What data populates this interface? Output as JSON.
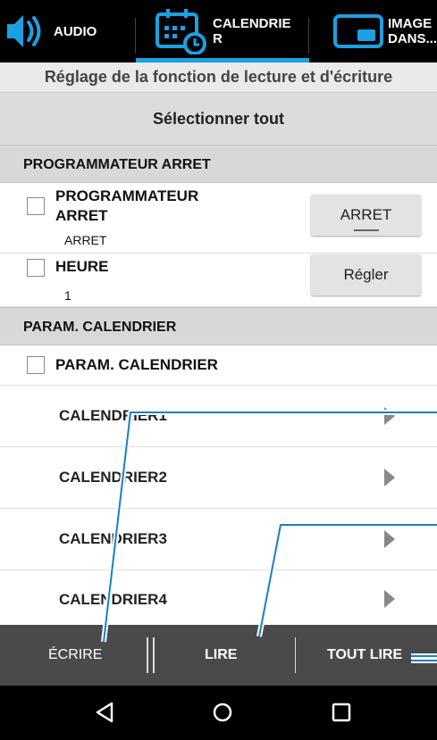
{
  "tabs": [
    {
      "label": "AUDIO",
      "icon": "speaker-icon"
    },
    {
      "label_line1": "CALENDRIE",
      "label_line2": "R",
      "icon": "calendar-clock-icon",
      "active": true
    },
    {
      "label_line1": "IMAGE",
      "label_line2": "DANS...",
      "icon": "picture-in-picture-icon"
    }
  ],
  "subtitle": "Réglage de la fonction de lecture et d'écriture",
  "select_all": "Sélectionner tout",
  "sections": {
    "timer": "PROGRAMMATEUR ARRET",
    "calendar": "PARAM. CALENDRIER"
  },
  "rows": {
    "timer_title_line1": "PROGRAMMATEUR",
    "timer_title_line2": "ARRET",
    "timer_value": "ARRET",
    "timer_button": "ARRET",
    "hour_title": "HEURE",
    "hour_value": "1",
    "hour_button": "Régler",
    "calendar_title": "PARAM. CALENDRIER"
  },
  "calendars": [
    "CALENDRIER1",
    "CALENDRIER2",
    "CALENDRIER3",
    "CALENDRIER4"
  ],
  "bottom_bar": {
    "write": "ÉCRIRE",
    "read": "LIRE",
    "read_all": "TOUT LIRE"
  },
  "colors": {
    "accent": "#1ba0e2",
    "callout": "#1a7fc4"
  }
}
